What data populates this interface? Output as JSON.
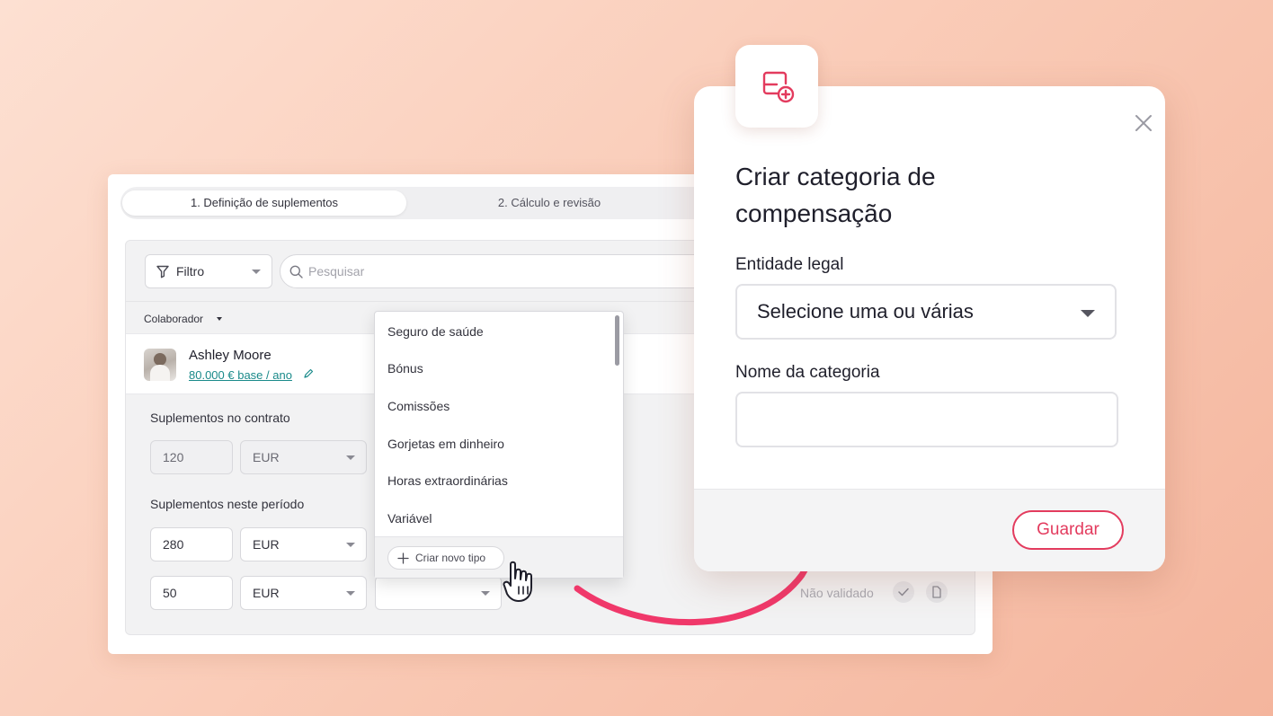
{
  "stepper": {
    "step1": "1. Definição de suplementos",
    "step2": "2. Cálculo e revisão"
  },
  "toolbar": {
    "filter_label": "Filtro",
    "search_placeholder": "Pesquisar"
  },
  "table": {
    "column_header": "Colaborador"
  },
  "employee": {
    "name": "Ashley Moore",
    "salary": "80.000 € base / ano"
  },
  "contract": {
    "label": "Suplementos no contrato",
    "amount": "120",
    "currency": "EUR"
  },
  "period": {
    "label": "Suplementos neste período",
    "rows": [
      {
        "amount": "280",
        "currency": "EUR"
      },
      {
        "amount": "50",
        "currency": "EUR",
        "type": "",
        "status": "Não validado"
      }
    ]
  },
  "dropdown": {
    "items": [
      "Seguro de saúde",
      "Bónus",
      "Comissões",
      "Gorjetas em dinheiro",
      "Horas extraordinárias",
      "Variável"
    ],
    "create_label": "Criar novo tipo"
  },
  "modal": {
    "title": "Criar categoria de compensação",
    "entity_label": "Entidade legal",
    "entity_placeholder": "Selecione uma ou várias",
    "name_label": "Nome da categoria",
    "name_value": "",
    "save_label": "Guardar"
  },
  "colors": {
    "accent": "#e33b5e",
    "link": "#1a8a8a",
    "background": "#f9c8b3"
  },
  "icons": [
    "filter-icon",
    "search-icon",
    "pencil-icon",
    "plus-icon",
    "check-icon",
    "document-icon",
    "close-icon",
    "add-category-icon",
    "hand-cursor-icon",
    "arrow-annotation"
  ]
}
